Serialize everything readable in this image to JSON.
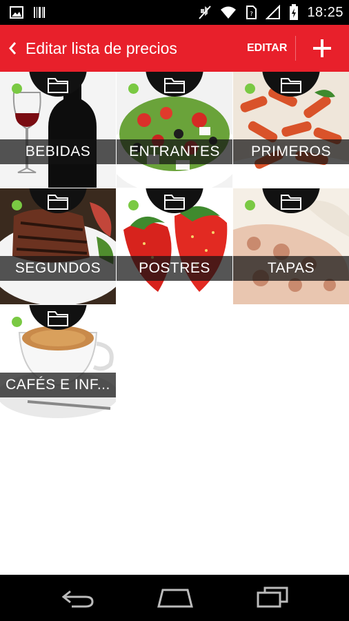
{
  "status_bar": {
    "time": "18:25",
    "icons": [
      "gallery-icon",
      "barcode-icon",
      "mute-icon",
      "wifi-icon",
      "sim-icon",
      "signal-icon",
      "battery-icon"
    ]
  },
  "header": {
    "title": "Editar lista de precios",
    "edit_label": "EDITAR",
    "back_icon": "back-chevron-icon",
    "add_icon": "plus-icon",
    "background_color": "#e8202b"
  },
  "categories": [
    {
      "label": "BEBIDAS",
      "image": "wine-bottle-glass",
      "active": true
    },
    {
      "label": "ENTRANTES",
      "image": "greek-salad",
      "active": true
    },
    {
      "label": "PRIMEROS",
      "image": "penne-pasta",
      "active": true
    },
    {
      "label": "SEGUNDOS",
      "image": "grilled-steak",
      "active": true
    },
    {
      "label": "POSTRES",
      "image": "strawberries",
      "active": true
    },
    {
      "label": "TAPAS",
      "image": "octopus",
      "active": true
    },
    {
      "label": "CAFÉS E INF...",
      "image": "espresso-cup",
      "active": true
    }
  ],
  "nav_bar": {
    "icons": [
      "back-icon",
      "home-icon",
      "recents-icon"
    ]
  }
}
